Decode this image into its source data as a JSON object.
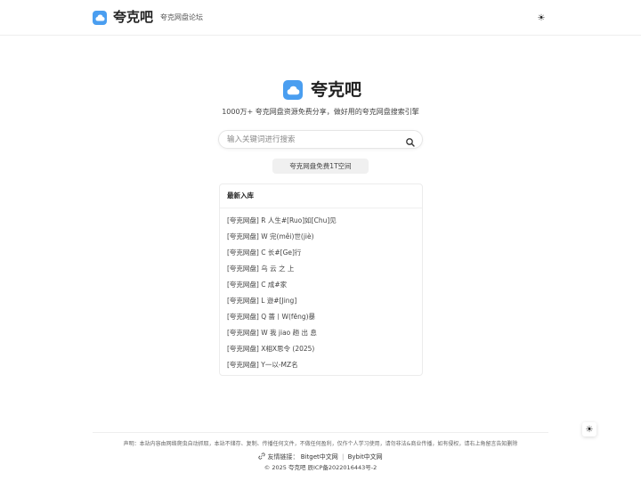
{
  "header": {
    "brand": "夸克吧",
    "nav_link": "夸克网盘论坛",
    "theme_icon": "sun-icon"
  },
  "hero": {
    "title": "夸克吧",
    "tagline": "1000万+ 夸克网盘资源免费分享，做好用的夸克网盘搜索引擎"
  },
  "search": {
    "placeholder": "输入关键词进行搜索",
    "value": "",
    "icon": "search-icon"
  },
  "promo": {
    "label": "夸克网盘免费1T空间"
  },
  "latest": {
    "title": "最新入库",
    "items": [
      "[夸克网盘] R 人生#[Ruo]如[Chu]见",
      "[夸克网盘] W 完(měi)世(jiè)",
      "[夸克网盘] C 长#[Ge]行",
      "[夸克网盘] 乌 云 之 上",
      "[夸克网盘] C 成#家",
      "[夸克网盘] L 逊#[Jing]",
      "[夸克网盘] Q 蔷丨W(fēng)暴",
      "[夸克网盘] W 我 jiao 趟 出 息",
      "[夸克网盘] X相X思令 (2025)",
      "[夸克网盘] Y一以-MZ名"
    ]
  },
  "footer": {
    "disclaimer": "声明：本站内容由网络爬虫自动抓取，本站不储存、复制、传播任何文件，不做任何盈利，仅作个人学习使用，请勿非法&商业传播，如有侵权，请右上角留言告知删除",
    "links_label": "友情链接：",
    "links": [
      "Bitget中文网",
      "Bybit中文网"
    ],
    "link_separator": "|",
    "copyright": "© 2025 夸克吧 辰ICP备2022016443号-2"
  },
  "colors": {
    "accent": "#4a9ef0",
    "text": "#333333",
    "border": "#eeeeee"
  }
}
